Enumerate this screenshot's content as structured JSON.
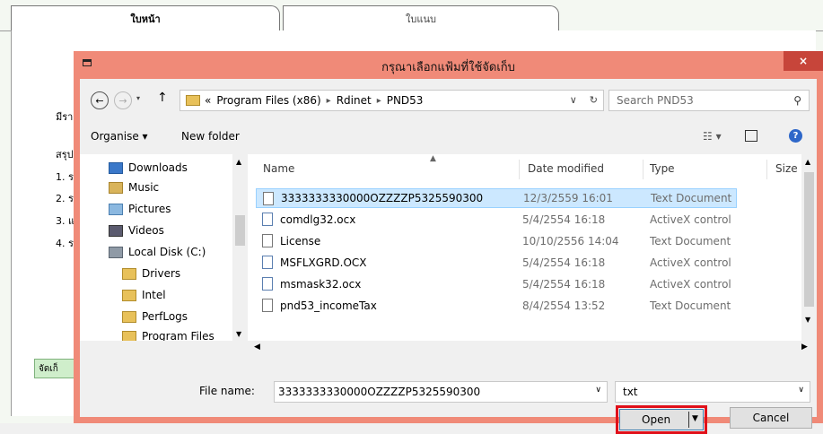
{
  "app": {
    "tabs": [
      {
        "label": "ใบหน้า"
      },
      {
        "label": "ใบแนบ"
      }
    ],
    "side_labels": [
      "มีรา",
      "สรุป",
      "1. ร",
      "2. ร",
      "3. แ",
      "4. ร"
    ],
    "bottom_button": "จัดเก็"
  },
  "dialog": {
    "title": "กรุณาเลือกแฟ้มที่ใช้จัดเก็บ",
    "close_glyph": "×",
    "address": {
      "overflow": "«",
      "crumbs": [
        "Program Files (x86)",
        "Rdinet",
        "PND53"
      ],
      "separator": "▸",
      "dropdown_glyph": "∨",
      "refresh_glyph": "↻"
    },
    "search": {
      "placeholder": "Search PND53",
      "icon": "search-icon"
    },
    "nav_buttons": {
      "back": "←",
      "forward": "→",
      "drop": "▾",
      "up": "↑"
    },
    "toolbar": {
      "organise": "Organise ▾",
      "new_folder": "New folder",
      "view": "☷ ▾",
      "help": "?"
    },
    "nav_pane": {
      "items": [
        {
          "label": "Downloads",
          "icon": "downloads-icon"
        },
        {
          "label": "Music",
          "icon": "music-icon"
        },
        {
          "label": "Pictures",
          "icon": "pictures-icon"
        },
        {
          "label": "Videos",
          "icon": "videos-icon"
        },
        {
          "label": "Local Disk (C:)",
          "icon": "local-disk-icon"
        },
        {
          "label": "Drivers",
          "icon": "folder-icon"
        },
        {
          "label": "Intel",
          "icon": "folder-icon"
        },
        {
          "label": "PerfLogs",
          "icon": "folder-icon"
        },
        {
          "label": "Program Files",
          "icon": "folder-icon"
        }
      ]
    },
    "columns": {
      "name": "Name",
      "date": "Date modified",
      "type": "Type",
      "size": "Size"
    },
    "files": [
      {
        "name": "3333333330000OZZZZP5325590300",
        "date": "12/3/2559 16:01",
        "type": "Text Document",
        "selected": true
      },
      {
        "name": "comdlg32.ocx",
        "date": "5/4/2554 16:18",
        "type": "ActiveX control",
        "selected": false
      },
      {
        "name": "License",
        "date": "10/10/2556 14:04",
        "type": "Text Document",
        "selected": false
      },
      {
        "name": "MSFLXGRD.OCX",
        "date": "5/4/2554 16:18",
        "type": "ActiveX control",
        "selected": false
      },
      {
        "name": "msmask32.ocx",
        "date": "5/4/2554 16:18",
        "type": "ActiveX control",
        "selected": false
      },
      {
        "name": "pnd53_incomeTax",
        "date": "8/4/2554 13:52",
        "type": "Text Document",
        "selected": false
      }
    ],
    "file_name": {
      "label": "File name:",
      "value": "3333333330000OZZZZP5325590300"
    },
    "file_type": {
      "value": "txt"
    },
    "buttons": {
      "open": "Open",
      "cancel": "Cancel"
    },
    "colors": {
      "title_bar": "#f08a78",
      "selection": "#cce8ff",
      "highlight_border": "#e0101a"
    }
  }
}
